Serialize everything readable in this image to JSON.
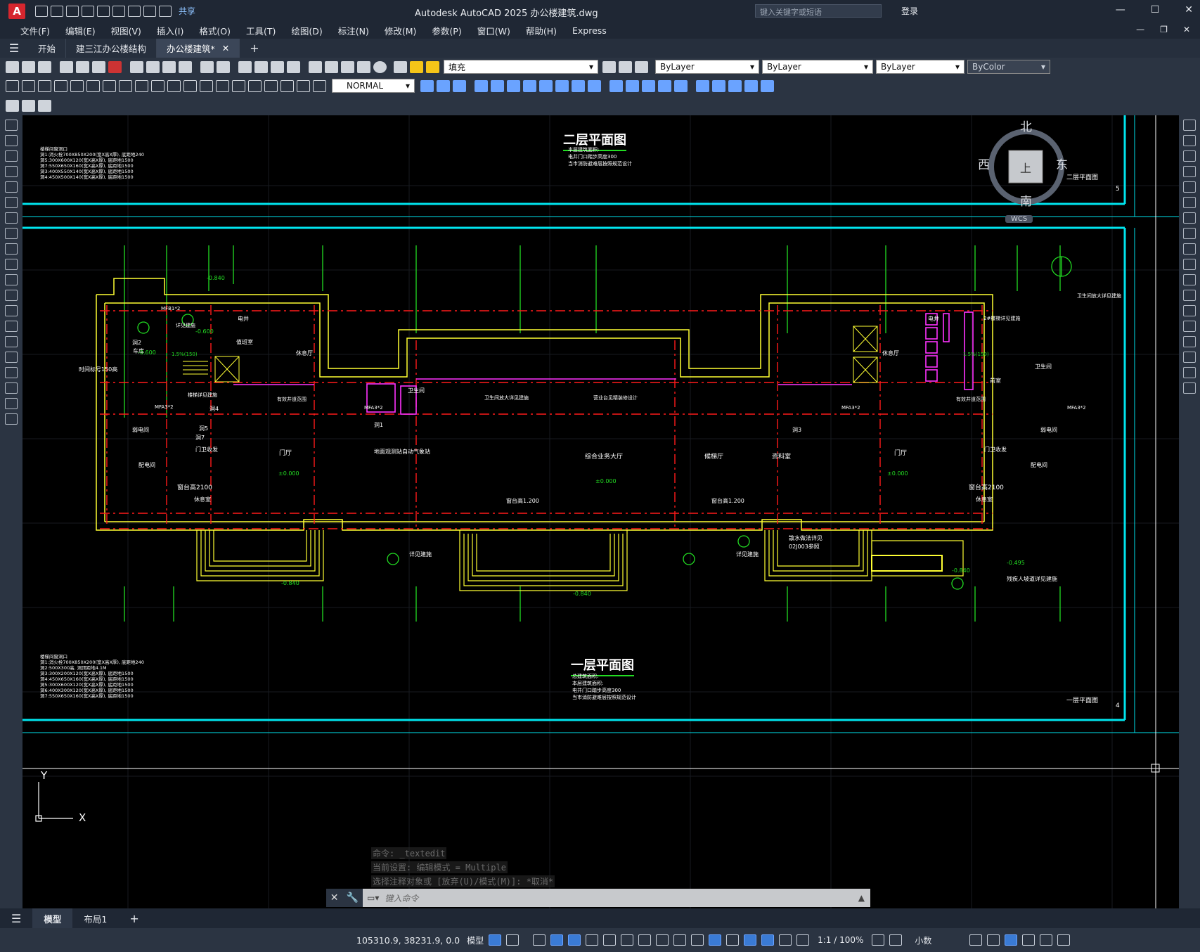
{
  "window": {
    "title": "Autodesk AutoCAD 2025    办公楼建筑.dwg",
    "app_letter": "A",
    "share": "共享",
    "search_placeholder": "键入关键字或短语",
    "login": "登录"
  },
  "menu": [
    "文件(F)",
    "编辑(E)",
    "视图(V)",
    "插入(I)",
    "格式(O)",
    "工具(T)",
    "绘图(D)",
    "标注(N)",
    "修改(M)",
    "参数(P)",
    "窗口(W)",
    "帮助(H)",
    "Express"
  ],
  "tabs": [
    "开始",
    "建三江办公楼结构",
    "办公楼建筑*"
  ],
  "toolbar": {
    "layer": "填充",
    "color": "ByLayer",
    "linetype": "ByLayer",
    "lineweight": "ByLayer",
    "plotstyle": "ByColor",
    "dimstyle": "NORMAL"
  },
  "viewcube": {
    "north": "北",
    "south": "南",
    "west": "西",
    "east": "东",
    "top": "上",
    "wcs": "WCS"
  },
  "drawing": {
    "title_upper": "二层平面图",
    "title_lower": "一层平面图",
    "upper_notes": [
      "本层建筑面积:",
      "电井门口踏步高度300",
      "当市消防避难层按照规范设计"
    ],
    "lower_notes": [
      "总建筑面积:",
      "本层建筑面积:",
      "电井门口踏步高度300",
      "当市消防避难层按照规范设计"
    ],
    "frame_label_upper": "二层平面图",
    "frame_label_lower": "一层平面图",
    "frame_num_upper": "5",
    "frame_num_lower": "4",
    "door_schedule_upper": [
      "楼梯间窗洞口",
      "洞1:消火栓700X850X200(宽X高X厚), 底距地240",
      "洞5:300X600X120(宽X高X厚), 底距地1500",
      "洞7:550X650X160(宽X高X厚), 底距地1500",
      "洞3:400X550X140(宽X高X厚), 底距地1500",
      "洞4:450X500X140(宽X高X厚), 底距地1500"
    ],
    "door_schedule_lower": [
      "楼梯间窗洞口",
      "洞1:消火栓700X850X200(宽X高X厚), 底距地240",
      "洞2:500X300高, 洞顶距地4.1M",
      "洞3:300X200X120(宽X高X厚), 底距地1500",
      "洞4:450X650X160(宽X高X厚), 底距地1500",
      "洞5:300X600X120(宽X高X厚), 底距地1500",
      "洞6:400X300X120(宽X高X厚), 底距地1500",
      "洞7:550X650X160(宽X高X厚), 底距地1500"
    ],
    "rooms": [
      "门厅",
      "地面观测站自动气象站",
      "综合业务大厅",
      "候梯厅",
      "资料室",
      "门厅",
      "门卫收发",
      "配电间",
      "弱电间",
      "弱电间",
      "门卫收发",
      "配电间",
      "值班室",
      "休息室",
      "休息室",
      "卫生间",
      "卫生间",
      "电井",
      "电井",
      "前室",
      "车库",
      "休息厅",
      "休息厅"
    ],
    "labels": [
      "±0.000",
      "±0.000",
      "±0.000",
      "-0.840",
      "-0.840",
      "-0.840",
      "-0.840",
      "-0.600",
      "-0.600",
      "-0.495",
      "窗台高2100",
      "窗台高2100",
      "窗台高1.200",
      "窗台高1.200",
      "详见建施",
      "详见建施",
      "详见建施",
      "有效井道范围",
      "有效井道范围",
      "卫生间放大详见建施",
      "卫生间放大详见建施",
      "营业台见精装修设计",
      "残疾人坡道详见建施",
      "散水做法详见",
      "02J003参照",
      "楼梯详见建施",
      "2#楼梯详见建施",
      "MFA3*2",
      "MFA3*2",
      "MFA3*2",
      "MFA3*2",
      "时间标号150高",
      "洞1",
      "洞2",
      "洞3",
      "洞4",
      "洞5",
      "洞7",
      "MFB1*2",
      "1.5%(150)",
      "1.5%(150)"
    ]
  },
  "command": {
    "history": [
      "命令: _textedit",
      "当前设置: 编辑模式 = Multiple",
      "选择注释对象或 [放弃(U)/模式(M)]: *取消*"
    ],
    "placeholder": "键入命令"
  },
  "layouts": [
    "模型",
    "布局1"
  ],
  "status": {
    "coords": "105310.9, 38231.9, 0.0",
    "model": "模型",
    "scale": "1:1 / 100%",
    "units": "小数"
  },
  "colors": {
    "canvas": "#000000",
    "cyan": "#00e5ee",
    "red": "#ff1a1a",
    "yellow": "#ffff33",
    "green": "#22dd22",
    "magenta": "#ff33ff",
    "accent": "#3a7bd5"
  }
}
